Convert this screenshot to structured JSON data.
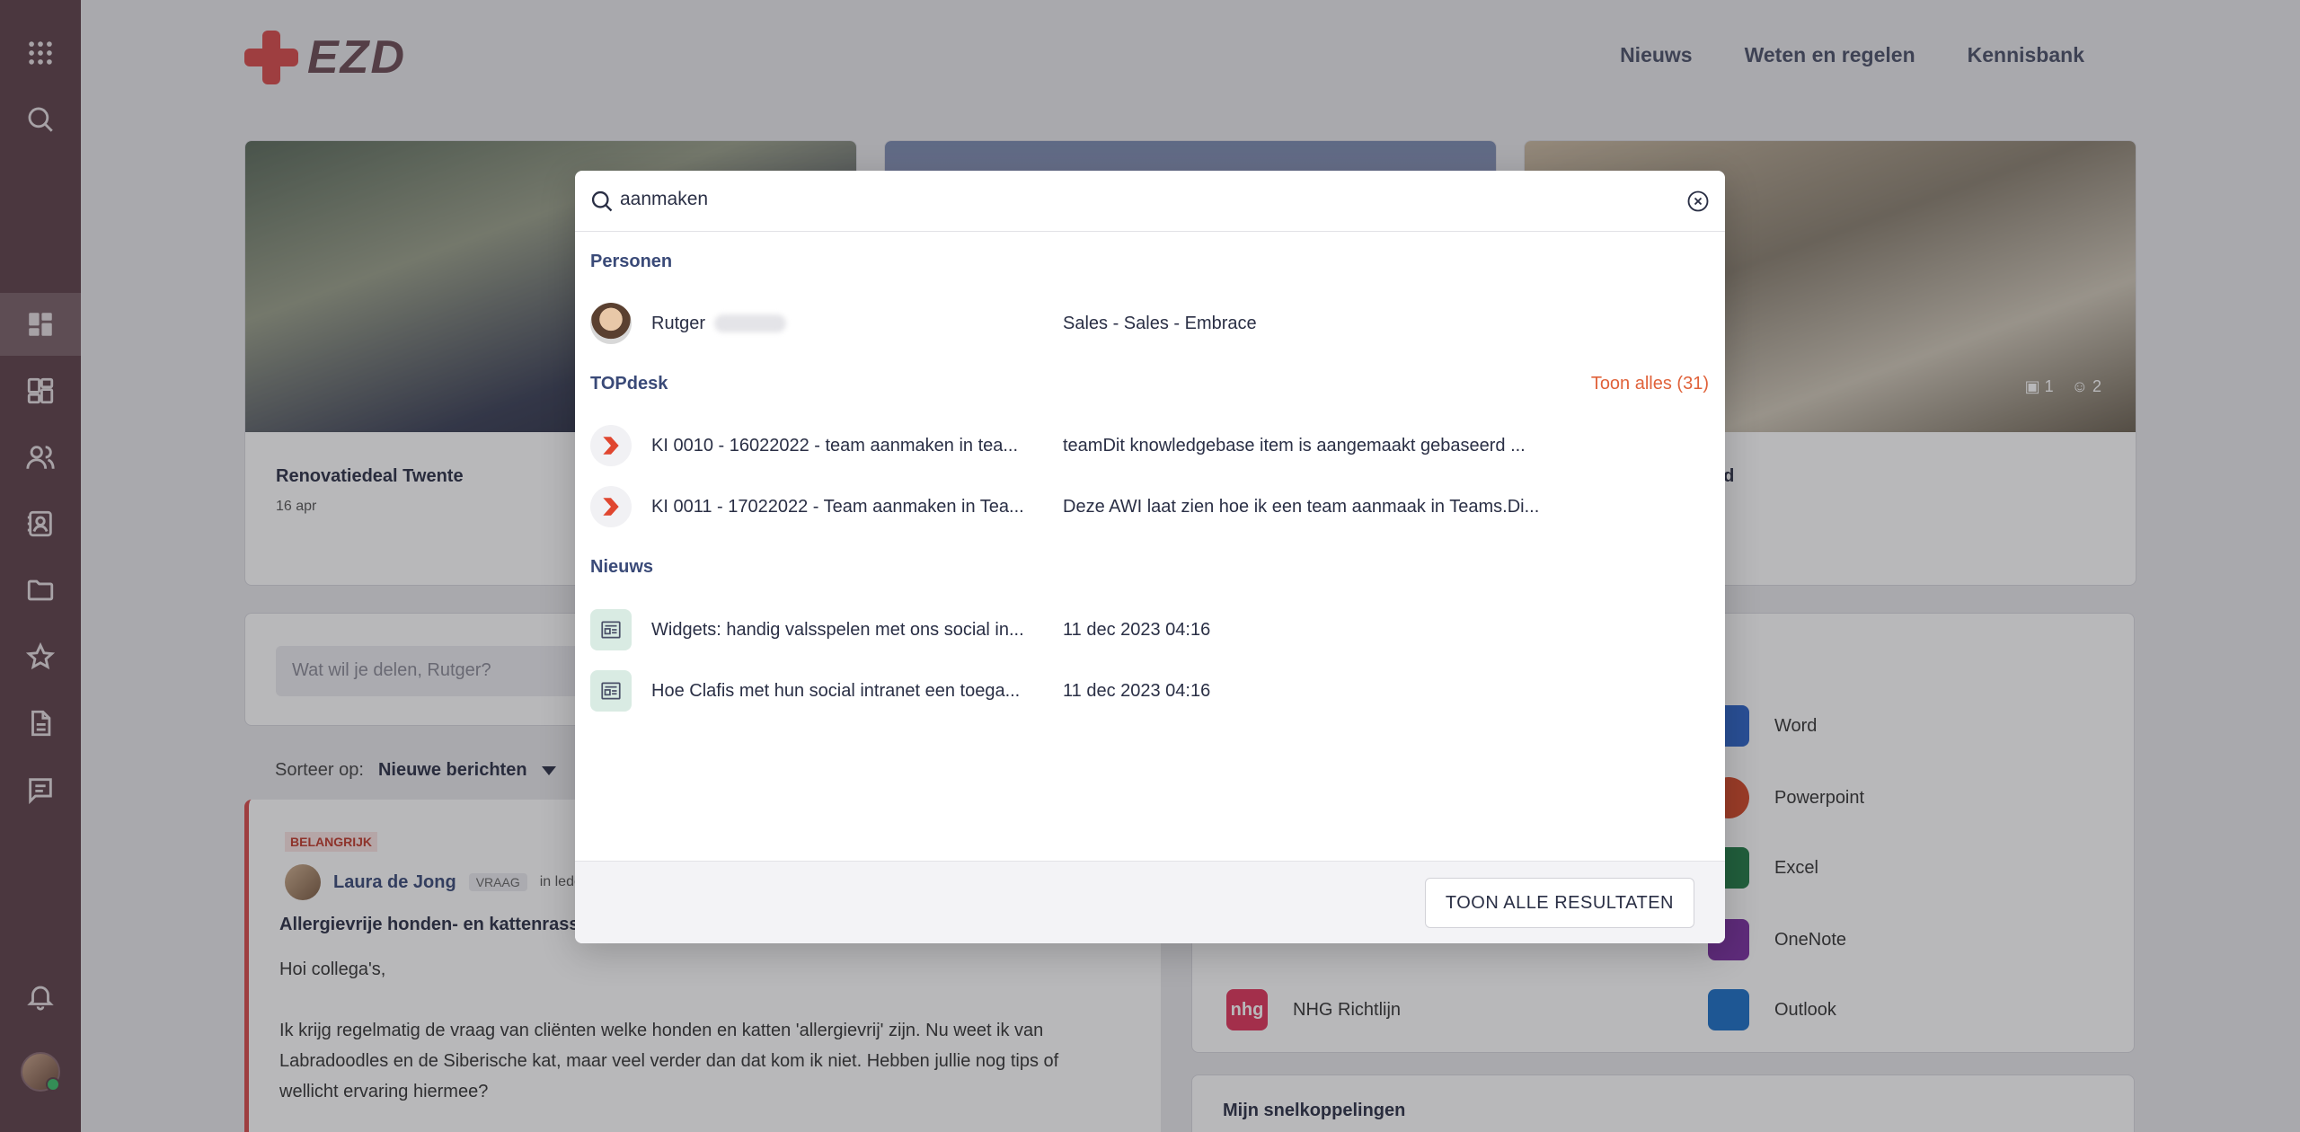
{
  "header": {
    "logo_text": "EZD",
    "nav": [
      "Nieuws",
      "Weten en regelen",
      "Kennisbank"
    ]
  },
  "cards": [
    {
      "title": "Renovatiedeal Twente",
      "date": "16 apr"
    },
    {
      "title": "",
      "date": ""
    },
    {
      "title": "t geld",
      "date": "",
      "comments": "1",
      "likes": "2"
    }
  ],
  "compose": {
    "placeholder": "Wat wil je delen, Rutger?"
  },
  "sort": {
    "label": "Sorteer op:",
    "value": "Nieuwe berichten"
  },
  "post": {
    "badge": "BELANGRIJK",
    "author": "Laura de Jong",
    "tag": "VRAAG",
    "location": "in leder",
    "title": "Allergievrije honden- en kattenrass",
    "greeting": "Hoi collega's,",
    "body": "Ik krijg regelmatig de vraag van cliënten welke honden en katten 'allergievrij' zijn. Nu weet ik van Labradoodles en de Siberische kat, maar veel verder dan dat kom ik niet. Hebben jullie nog tips of wellicht ervaring hiermee?"
  },
  "apps": [
    {
      "name": "NHG Richtlijn",
      "icon": "nhg-icon",
      "color": "#e0335a"
    },
    {
      "name": "Word",
      "icon": "word-icon",
      "color": "#2b63c8"
    },
    {
      "name": "Powerpoint",
      "icon": "powerpoint-icon",
      "color": "#d24726"
    },
    {
      "name": "Excel",
      "icon": "excel-icon",
      "color": "#1e7a44"
    },
    {
      "name": "OneNote",
      "icon": "onenote-icon",
      "color": "#7a2ea0"
    },
    {
      "name": "Outlook",
      "icon": "outlook-icon",
      "color": "#1a6fc6"
    }
  ],
  "snelkoppelingen": {
    "title": "Mijn snelkoppelingen"
  },
  "search": {
    "query": "aanmaken",
    "sections": {
      "personen": {
        "title": "Personen",
        "items": [
          {
            "name": "Rutger",
            "dept": "Sales - Sales - Embrace"
          }
        ]
      },
      "topdesk": {
        "title": "TOPdesk",
        "show_all": "Toon alles (31)",
        "items": [
          {
            "title": "KI 0010 - 16022022 - team aanmaken in tea...",
            "desc": "teamDit knowledgebase item is aangemaakt gebaseerd ..."
          },
          {
            "title": "KI 0011 - 17022022 - Team aanmaken in Tea...",
            "desc": "Deze AWI laat zien hoe ik een team aanmaak in Teams.Di..."
          }
        ]
      },
      "nieuws": {
        "title": "Nieuws",
        "items": [
          {
            "title": "Widgets: handig valsspelen met ons social in...",
            "date": "11 dec 2023 04:16"
          },
          {
            "title": "Hoe Clafis met hun social intranet een toega...",
            "date": "11 dec 2023 04:16"
          }
        ]
      }
    },
    "show_all_button": "TOON ALLE RESULTATEN"
  }
}
